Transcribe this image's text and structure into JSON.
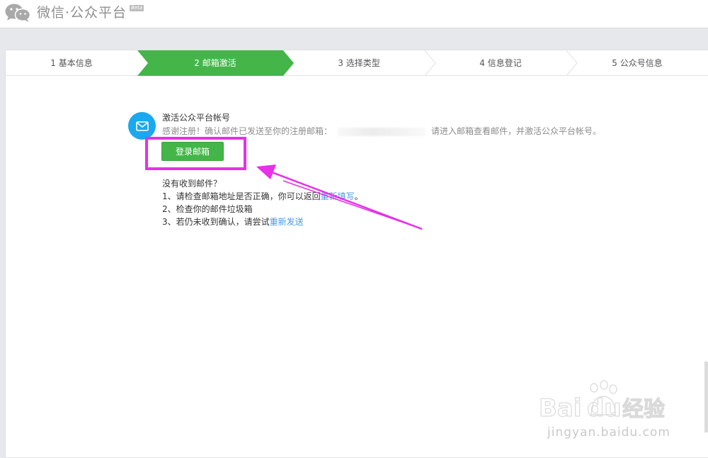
{
  "header": {
    "logo_text": "微信·公众平台",
    "beta_badge": "Beta"
  },
  "steps": [
    {
      "label": "1 基本信息",
      "active": false
    },
    {
      "label": "2 邮箱激活",
      "active": true
    },
    {
      "label": "3 选择类型",
      "active": false
    },
    {
      "label": "4 信息登记",
      "active": false
    },
    {
      "label": "5 公众号信息",
      "active": false
    }
  ],
  "activation": {
    "title": "激活公众平台帐号",
    "desc_before": "感谢注册！确认邮件已发送至你的注册邮箱：",
    "desc_after": "请进入邮箱查看邮件，并激活公众平台帐号。",
    "login_button": "登录邮箱"
  },
  "help": {
    "heading": "没有收到邮件？",
    "line1_text": "1、请检查邮箱地址是否正确，你可以返回",
    "line1_link": "重新填写",
    "line1_end": "。",
    "line2_text": "2、检查你的邮件垃圾箱",
    "line3_text": "3、若仍未收到确认，请尝试",
    "line3_link": "重新发送"
  },
  "watermark": {
    "brand": "Bai",
    "brand_tail": "du",
    "product": "经验",
    "url": "jingyan.baidu.com"
  },
  "colors": {
    "active_step": "#44b549",
    "primary_button": "#44b549",
    "link": "#459ae9",
    "mail_icon_bg": "#1aa8f0",
    "annotation": "#e631e6"
  }
}
